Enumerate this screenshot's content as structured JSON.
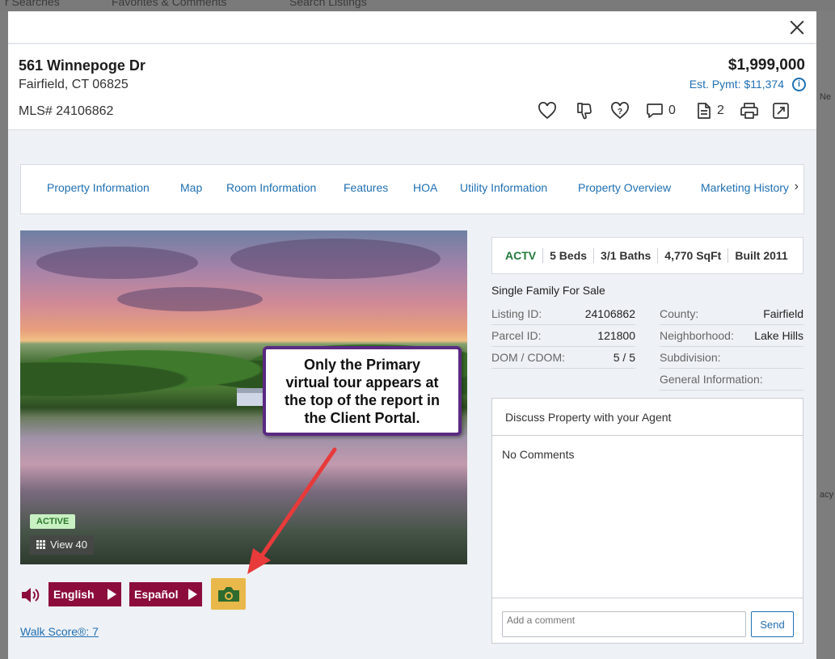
{
  "background": {
    "nav_items": [
      "r Searches",
      "Favorites & Comments",
      "Search Listings"
    ],
    "side_texts": [
      "Ne",
      "acy"
    ]
  },
  "header": {
    "address_line1": "561 Winnepoge Dr",
    "address_line2": "Fairfield, CT 06825",
    "mls": "MLS# 24106862",
    "price": "$1,999,000",
    "est_payment": "Est. Pymt: $11,374",
    "comment_count": "0",
    "document_count": "2"
  },
  "tabs": [
    "Property Information",
    "Map",
    "Room Information",
    "Features",
    "HOA",
    "Utility Information",
    "Property Overview",
    "Marketing History"
  ],
  "photo": {
    "status_badge": "ACTIVE",
    "view_label": "View 40"
  },
  "tour": {
    "english_label": "English",
    "spanish_label": "Español",
    "walk_score": "Walk Score®: 7"
  },
  "stats": [
    "ACTV",
    "5 Beds",
    "3/1 Baths",
    "4,770 SqFt",
    "Built 2011"
  ],
  "property_type": "Single Family For Sale",
  "details_left": [
    {
      "label": "Listing ID:",
      "value": "24106862"
    },
    {
      "label": "Parcel ID:",
      "value": "121800"
    },
    {
      "label": "DOM / CDOM:",
      "value": "5 / 5"
    }
  ],
  "details_right": [
    {
      "label": "County:",
      "value": "Fairfield"
    },
    {
      "label": "Neighborhood:",
      "value": "Lake Hills"
    },
    {
      "label": "Subdivision:",
      "value": ""
    },
    {
      "label": "General Information:",
      "value": ""
    }
  ],
  "discuss": {
    "title": "Discuss Property with your Agent",
    "empty_text": "No Comments",
    "input_placeholder": "Add a comment",
    "send_label": "Send"
  },
  "annotation": {
    "text": "Only the Primary\nvirtual tour appears at\nthe top of the report in\nthe Client Portal."
  },
  "colors": {
    "accent_blue": "#1f6fb2",
    "tour_button_maroon": "#8c0d3c",
    "virtual_tour_gold": "#e8b84a",
    "active_green": "#237a3c",
    "callout_border": "#5b2a82",
    "arrow_red": "#e83a3a"
  }
}
